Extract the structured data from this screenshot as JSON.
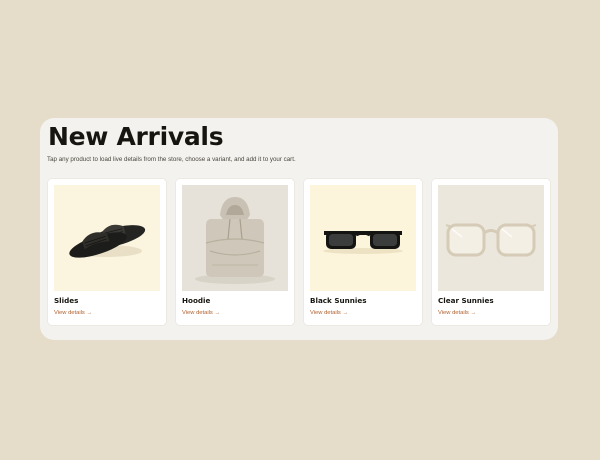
{
  "section": {
    "title": "New Arrivals",
    "subtitle": "Tap any product to load live details from the store, choose a variant, and add it to your cart."
  },
  "products": [
    {
      "name": "Slides",
      "link": "View details →",
      "image": "black-slide-sandals",
      "bg": "#fbf4df"
    },
    {
      "name": "Hoodie",
      "link": "View details →",
      "image": "folded-grey-hoodie",
      "bg": "#e6e2d9"
    },
    {
      "name": "Black Sunnies",
      "link": "View details →",
      "image": "black-sunglasses",
      "bg": "#fdf4dc"
    },
    {
      "name": "Clear Sunnies",
      "link": "View details →",
      "image": "clear-frame-glasses",
      "bg": "#ebe7dd"
    }
  ],
  "colors": {
    "page_bg": "#e5ddca",
    "panel_bg": "#f3f2ee",
    "link": "#b05e2c"
  }
}
